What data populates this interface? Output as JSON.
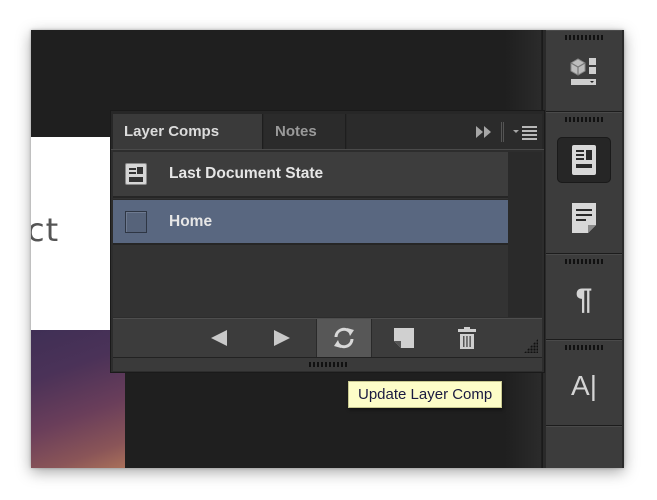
{
  "canvas": {
    "partial_text": "ct"
  },
  "panel": {
    "tabs": [
      {
        "label": "Layer Comps",
        "active": true
      },
      {
        "label": "Notes",
        "active": false
      }
    ],
    "tab_tools": {
      "collapse_icon": "double-arrow-right",
      "menu_icon": "panel-menu"
    },
    "rows": [
      {
        "label": "Last Document State",
        "icon": "document-state-icon",
        "selected": false
      },
      {
        "label": "Home",
        "icon": "checkbox",
        "selected": true
      }
    ],
    "toolbar": [
      {
        "name": "previous-comp",
        "glyph": "◀"
      },
      {
        "name": "next-comp",
        "glyph": "▶"
      },
      {
        "name": "update-comp",
        "glyph": "⟳",
        "pressed": true
      },
      {
        "name": "new-comp",
        "glyph": "◩"
      },
      {
        "name": "delete-comp",
        "glyph": "🗑"
      }
    ]
  },
  "tooltip": {
    "text": "Update Layer Comp"
  },
  "dock": {
    "buttons": [
      {
        "name": "3d-panel",
        "glyph": "⬡"
      },
      {
        "name": "layer-comps",
        "glyph": "▤",
        "active": true
      },
      {
        "name": "notes",
        "glyph": "≣"
      },
      {
        "name": "paragraph",
        "glyph": "¶"
      },
      {
        "name": "character",
        "glyph": "A|"
      }
    ]
  },
  "colors": {
    "selected_row": "#596780",
    "tooltip_bg": "#fdfdc8",
    "panel_bg": "#2d2d2d"
  }
}
